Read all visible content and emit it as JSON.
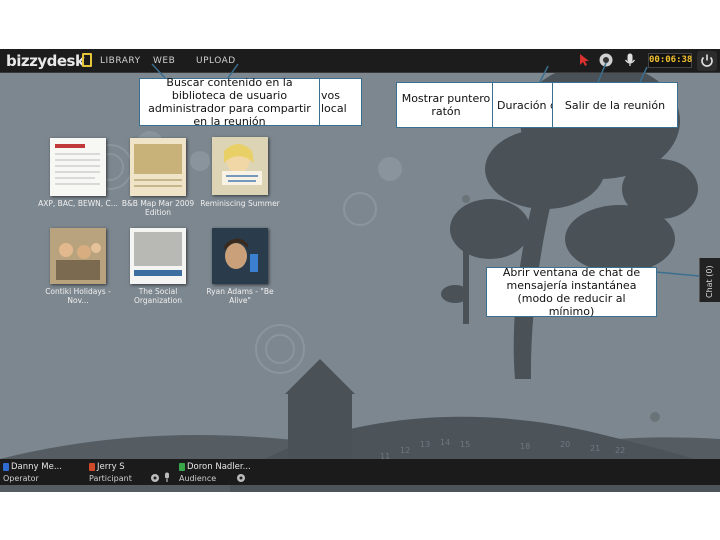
{
  "app": {
    "logo": "bizzydesk",
    "nav": [
      "LIBRARY",
      "WEB",
      "UPLOAD"
    ],
    "timer": "00:06:38",
    "chat_tab": "Chat (0)"
  },
  "library": {
    "items": [
      {
        "label": "AXP, BAC, BEWN, C..."
      },
      {
        "label": "B&B Map Mar 2009 Edition"
      },
      {
        "label": "Reminiscing Summer"
      },
      {
        "label": "Contiki Holidays - Nov..."
      },
      {
        "label": "The Social Organization"
      },
      {
        "label": "Ryan Adams - \"Be Alive\""
      }
    ]
  },
  "callouts": {
    "library": "Buscar contenido en la biblioteca de usuario administrador para compartir en la reunión",
    "upload_partial": "vos\nlocal",
    "pointer": "Mostrar puntero ratón",
    "duration": "Duración de",
    "exit": "Salir de la reunión",
    "chat": "Abrir ventana de chat de mensajería instantánea (modo de reducir al mínimo)"
  },
  "participants": [
    {
      "name": "Danny Me...",
      "role": "Operator",
      "color": "#2f6bd0"
    },
    {
      "name": "Jerry S",
      "role": "Participant",
      "color": "#d04a2a"
    },
    {
      "name": "Doron Nadler...",
      "role": "Audience",
      "color": "#3aa64a"
    }
  ],
  "colors": {
    "timer": "#f2c12e",
    "callout_border": "#3b6f8f",
    "background": "#7d878f"
  }
}
